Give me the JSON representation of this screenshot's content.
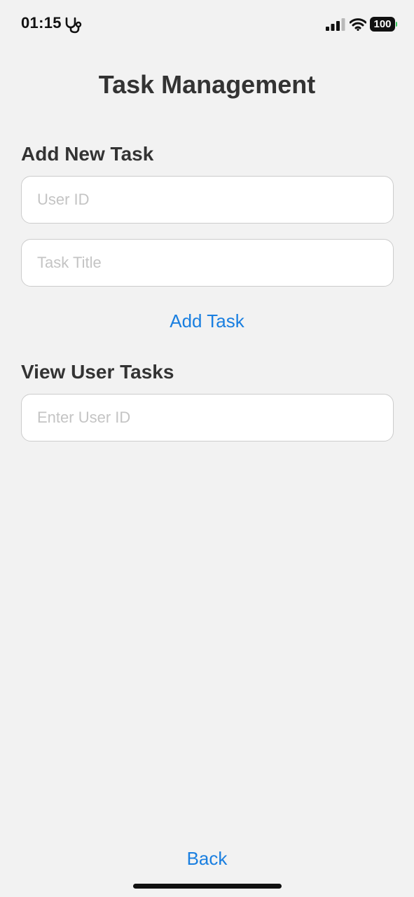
{
  "status_bar": {
    "time": "01:15",
    "battery_level": "100",
    "activity_icon": "stethoscope-icon",
    "signal_icon": "cellular-signal-icon",
    "wifi_icon": "wifi-icon"
  },
  "page": {
    "title": "Task Management"
  },
  "add_task": {
    "heading": "Add New Task",
    "user_id_placeholder": "User ID",
    "task_title_placeholder": "Task Title",
    "button_label": "Add Task"
  },
  "view_tasks": {
    "heading": "View User Tasks",
    "user_id_placeholder": "Enter User ID"
  },
  "footer": {
    "back_label": "Back"
  },
  "colors": {
    "background": "#f2f2f2",
    "text": "#333333",
    "accent": "#1a7fe0",
    "placeholder": "#c4c4c4",
    "field_border": "#cccccc"
  }
}
